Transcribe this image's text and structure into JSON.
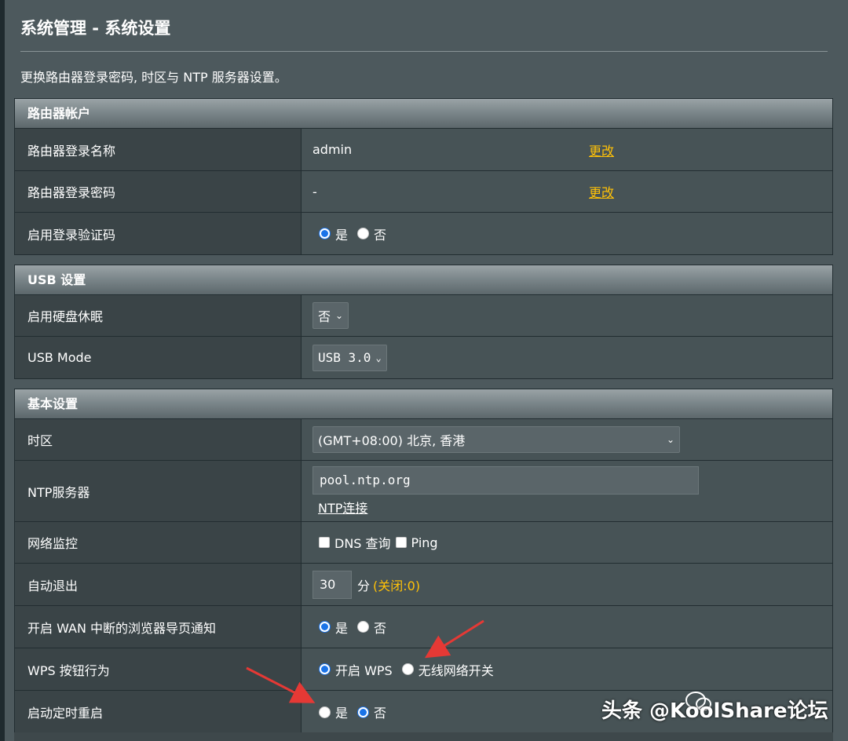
{
  "page": {
    "title": "系统管理 - 系统设置",
    "description": "更换路由器登录密码, 时区与 NTP 服务器设置。"
  },
  "router_account": {
    "header": "路由器帐户",
    "login_name_label": "路由器登录名称",
    "login_name_value": "admin",
    "login_name_change": "更改",
    "login_password_label": "路由器登录密码",
    "login_password_value": "-",
    "login_password_change": "更改",
    "captcha_label": "启用登录验证码",
    "captcha_yes": "是",
    "captcha_no": "否",
    "captcha_selected": "是"
  },
  "usb": {
    "header": "USB 设置",
    "hdd_sleep_label": "启用硬盘休眠",
    "hdd_sleep_value": "否",
    "usb_mode_label": "USB Mode",
    "usb_mode_value": "USB 3.0"
  },
  "basic": {
    "header": "基本设置",
    "timezone_label": "时区",
    "timezone_value": "(GMT+08:00) 北京, 香港",
    "ntp_label": "NTP服务器",
    "ntp_value": "pool.ntp.org",
    "ntp_link": "NTP连接",
    "netmon_label": "网络监控",
    "netmon_dns": "DNS 查询",
    "netmon_ping": "Ping",
    "autologout_label": "自动退出",
    "autologout_value": "30",
    "autologout_unit": "分",
    "autologout_note": "(关闭:0)",
    "wan_redirect_label": "开启 WAN 中断的浏览器导页通知",
    "wan_redirect_yes": "是",
    "wan_redirect_no": "否",
    "wan_redirect_selected": "是",
    "wps_label": "WPS 按钮行为",
    "wps_opt1": "开启 WPS",
    "wps_opt2": "无线网络开关",
    "wps_selected": "开启 WPS",
    "reboot_label": "启动定时重启",
    "reboot_yes": "是",
    "reboot_no": "否",
    "reboot_selected": "否"
  },
  "watermark": {
    "text": "头条 @KoolShare论坛"
  },
  "colors": {
    "background": "#4d595d",
    "label_bg": "#3a4447",
    "value_bg": "#475356",
    "link": "#ffc107",
    "radio_accent": "#1a73e8",
    "annotation_arrow": "#e53935"
  },
  "icons": {
    "dropdown": "chevron-down-icon",
    "annotation": "red-arrow-icon",
    "watermark": "wechat-icon"
  }
}
